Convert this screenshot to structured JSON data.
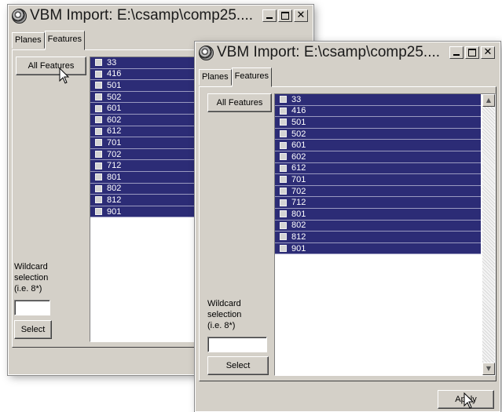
{
  "windows": [
    {
      "title": "VBM Import: E:\\csamp\\comp25....",
      "tabs": [
        "Planes",
        "Features"
      ],
      "all_features_label": "All Features",
      "wildcard_label": [
        "Wildcard",
        "selection",
        "(i.e. 8*)"
      ],
      "select_label": "Select",
      "wildcard_value": "",
      "features": [
        "33",
        "416",
        "501",
        "502",
        "601",
        "602",
        "612",
        "701",
        "702",
        "712",
        "801",
        "802",
        "812",
        "901"
      ]
    },
    {
      "title": "VBM Import: E:\\csamp\\comp25....",
      "tabs": [
        "Planes",
        "Features"
      ],
      "all_features_label": "All Features",
      "wildcard_label": [
        "Wildcard",
        "selection",
        "(i.e. 8*)"
      ],
      "select_label": "Select",
      "wildcard_value": "",
      "apply_label": "Apply",
      "features": [
        "33",
        "416",
        "501",
        "502",
        "601",
        "602",
        "612",
        "701",
        "702",
        "712",
        "801",
        "802",
        "812",
        "901"
      ]
    }
  ],
  "colors": {
    "selection": "#2c2c76",
    "dialog": "#d4d0c8"
  },
  "icons": [
    "app-globe-icon",
    "minimize-icon",
    "maximize-icon",
    "close-icon",
    "scroll-up-arrow-icon",
    "scroll-down-arrow-icon",
    "mouse-pointer-icon"
  ]
}
